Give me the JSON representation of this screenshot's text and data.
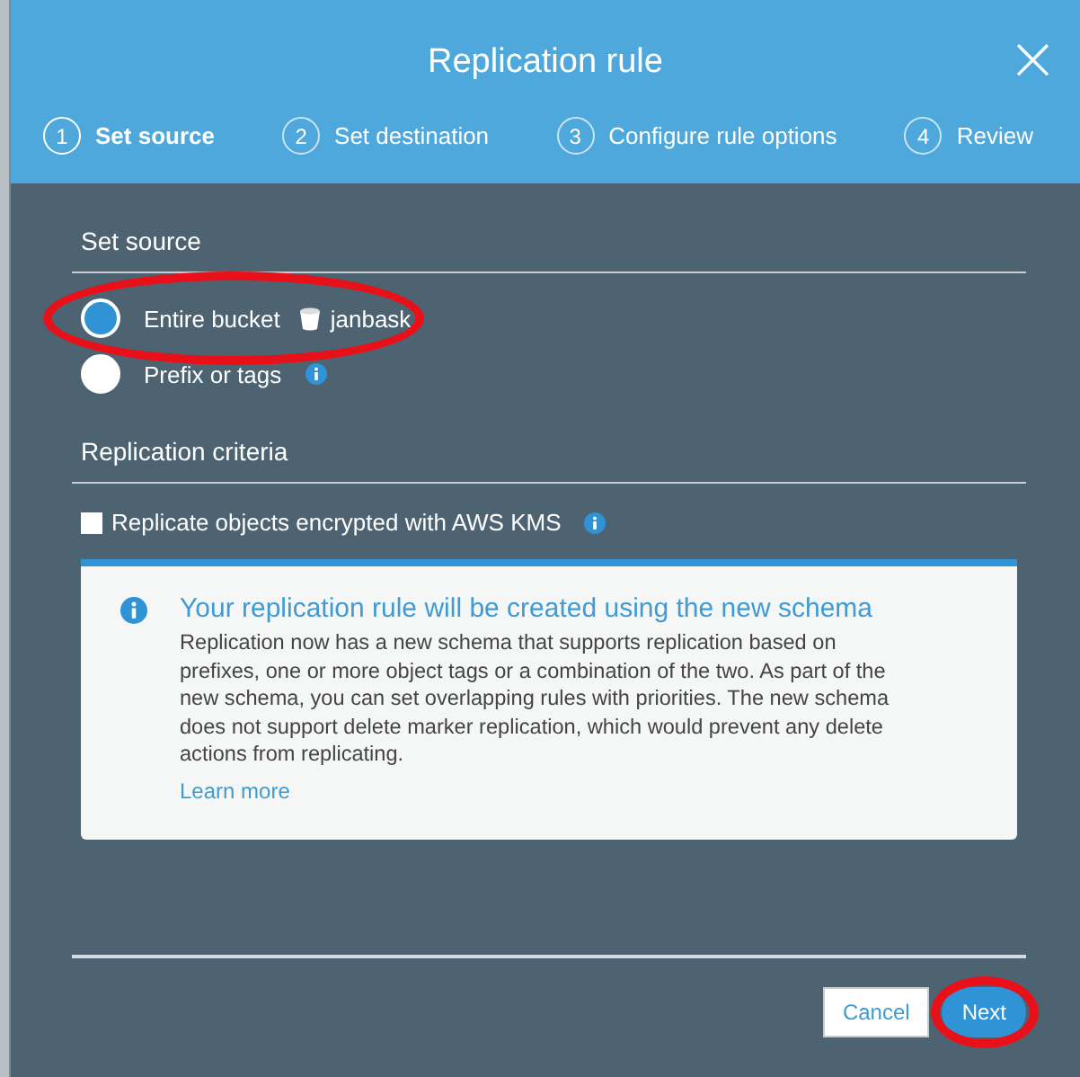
{
  "dialog": {
    "title": "Replication rule",
    "close": "×"
  },
  "steps": [
    {
      "number": "1",
      "label": "Set source",
      "selected": true
    },
    {
      "number": "2",
      "label": "Set destination",
      "selected": false
    },
    {
      "number": "3",
      "label": "Configure rule options",
      "selected": false
    },
    {
      "number": "4",
      "label": "Review",
      "selected": false
    }
  ],
  "source": {
    "heading": "Set source",
    "options": [
      {
        "label": "Entire bucket",
        "bucket": "janbask",
        "selected": true,
        "info": false
      },
      {
        "label": "Prefix or tags",
        "selected": false,
        "info": true
      }
    ]
  },
  "criteria": {
    "heading": "Replication criteria",
    "checkbox": {
      "label": "Replicate objects encrypted with AWS KMS",
      "checked": false
    }
  },
  "notice": {
    "title": "Your replication rule will be created using the new schema",
    "body": "Replication now has a new schema that supports replication based on prefixes, one or more object tags or a combination of the two. As part of the new schema, you can set overlapping rules with priorities. The new schema does not support delete marker replication, which would prevent any delete actions from replicating.",
    "link": "Learn more"
  },
  "buttons": {
    "cancel": "Cancel",
    "next": "Next"
  }
}
